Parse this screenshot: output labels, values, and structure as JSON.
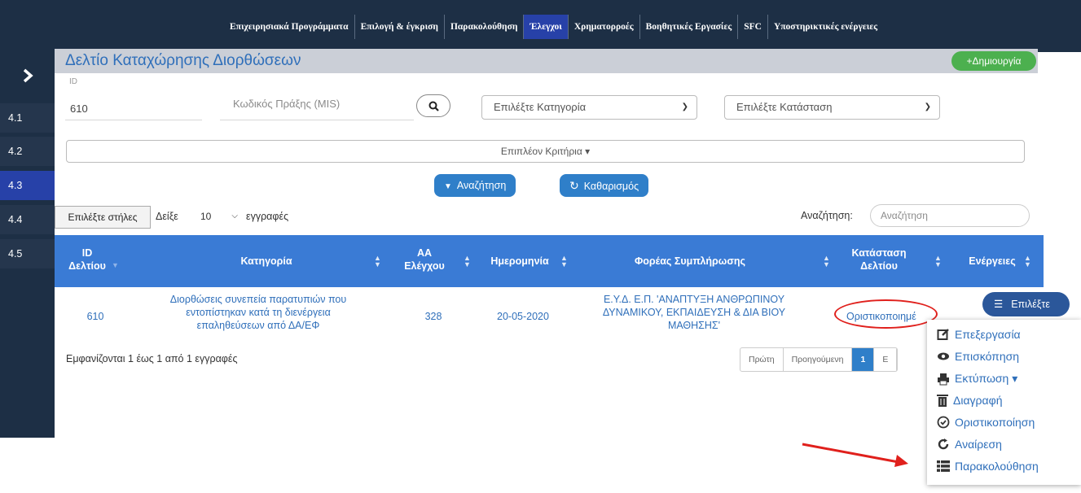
{
  "nav": {
    "items": [
      "Επιχειρησιακά Προγράμματα",
      "Επιλογή & έγκριση",
      "Παρακολούθηση",
      "Έλεγχοι",
      "Χρηματορροές",
      "Βοηθητικές Εργασίες",
      "SFC",
      "Υποστηρικτικές ενέργειες"
    ],
    "active": "Έλεγχοι"
  },
  "sidebar": {
    "toggle_icon": "chevron-right-icon",
    "items": [
      "4.1",
      "4.2",
      "4.3",
      "4.4",
      "4.5"
    ],
    "active": "4.3"
  },
  "header": {
    "title": "Δελτίο Καταχώρησης Διορθώσεων",
    "create_label": "+Δημιουργία"
  },
  "filters": {
    "id_label": "ID",
    "id_value": "610",
    "mis_placeholder": "Κωδικός Πράξης (MIS)",
    "category_placeholder": "Επιλέξτε Κατηγορία",
    "status_placeholder": "Επιλέξτε Κατάσταση",
    "more_criteria": "Επιπλέον Κριτήρια ▾",
    "search_button": "Αναζήτηση",
    "clear_button": "Καθαρισμός"
  },
  "table_controls": {
    "columns_button": "Επιλέξτε στήλες",
    "show_prefix": "Δείξε",
    "page_size": "10",
    "show_suffix": "εγγραφές",
    "search_label": "Αναζήτηση:",
    "search_placeholder": "Αναζήτηση"
  },
  "table": {
    "headers": {
      "id_line1": "ID",
      "id_line2": "Δελτίου",
      "category": "Κατηγορία",
      "aa_line1": "ΑΑ",
      "aa_line2": "Ελέγχου",
      "date": "Ημερομηνία",
      "agency": "Φορέας Συμπλήρωσης",
      "status_line1": "Κατάσταση",
      "status_line2": "Δελτίου",
      "actions": "Ενέργειες"
    },
    "rows": [
      {
        "id": "610",
        "category_lines": [
          "Διορθώσεις συνεπεία παρατυπιών που",
          "εντοπίστηκαν κατά τη διενέργεια",
          "επαληθεύσεων από ΔΑ/ΕΦ"
        ],
        "aa": "328",
        "date": "20-05-2020",
        "agency_lines": [
          "Ε.Υ.Δ. Ε.Π. 'ΑΝΑΠΤΥΞΗ ΑΝΘΡΩΠΙΝΟΥ",
          "ΔΥΝΑΜΙΚΟΥ, ΕΚΠΑΙΔΕΥΣΗ & ΔΙΑ ΒΙΟΥ",
          "ΜΑΘΗΣΗΣ'"
        ],
        "status": "Οριστικοποιημέ",
        "action_button": "Επιλέξτε"
      }
    ],
    "info": "Εμφανίζονται 1 έως 1 από 1 εγγραφές"
  },
  "pagination": {
    "first": "Πρώτη",
    "prev": "Προηγούμενη",
    "current": "1",
    "next_partial": "Ε"
  },
  "dropdown_menu": {
    "items": [
      {
        "label": "Επεξεργασία",
        "icon": "edit-icon"
      },
      {
        "label": "Επισκόπηση",
        "icon": "eye-icon"
      },
      {
        "label": "Εκτύπωση ▾",
        "icon": "print-icon"
      },
      {
        "label": "Διαγραφή",
        "icon": "trash-icon"
      },
      {
        "label": "Οριστικοποίηση",
        "icon": "check-circle-icon"
      },
      {
        "label": "Αναίρεση",
        "icon": "undo-icon"
      },
      {
        "label": "Παρακολούθηση",
        "icon": "list-icon"
      }
    ]
  },
  "colors": {
    "nav_bg": "#1d2f45",
    "active_blue": "#2741a8",
    "table_header": "#3a7bd5",
    "create_green": "#4cb04f",
    "link_blue": "#2f6fba",
    "annotation_red": "#e0201c"
  }
}
